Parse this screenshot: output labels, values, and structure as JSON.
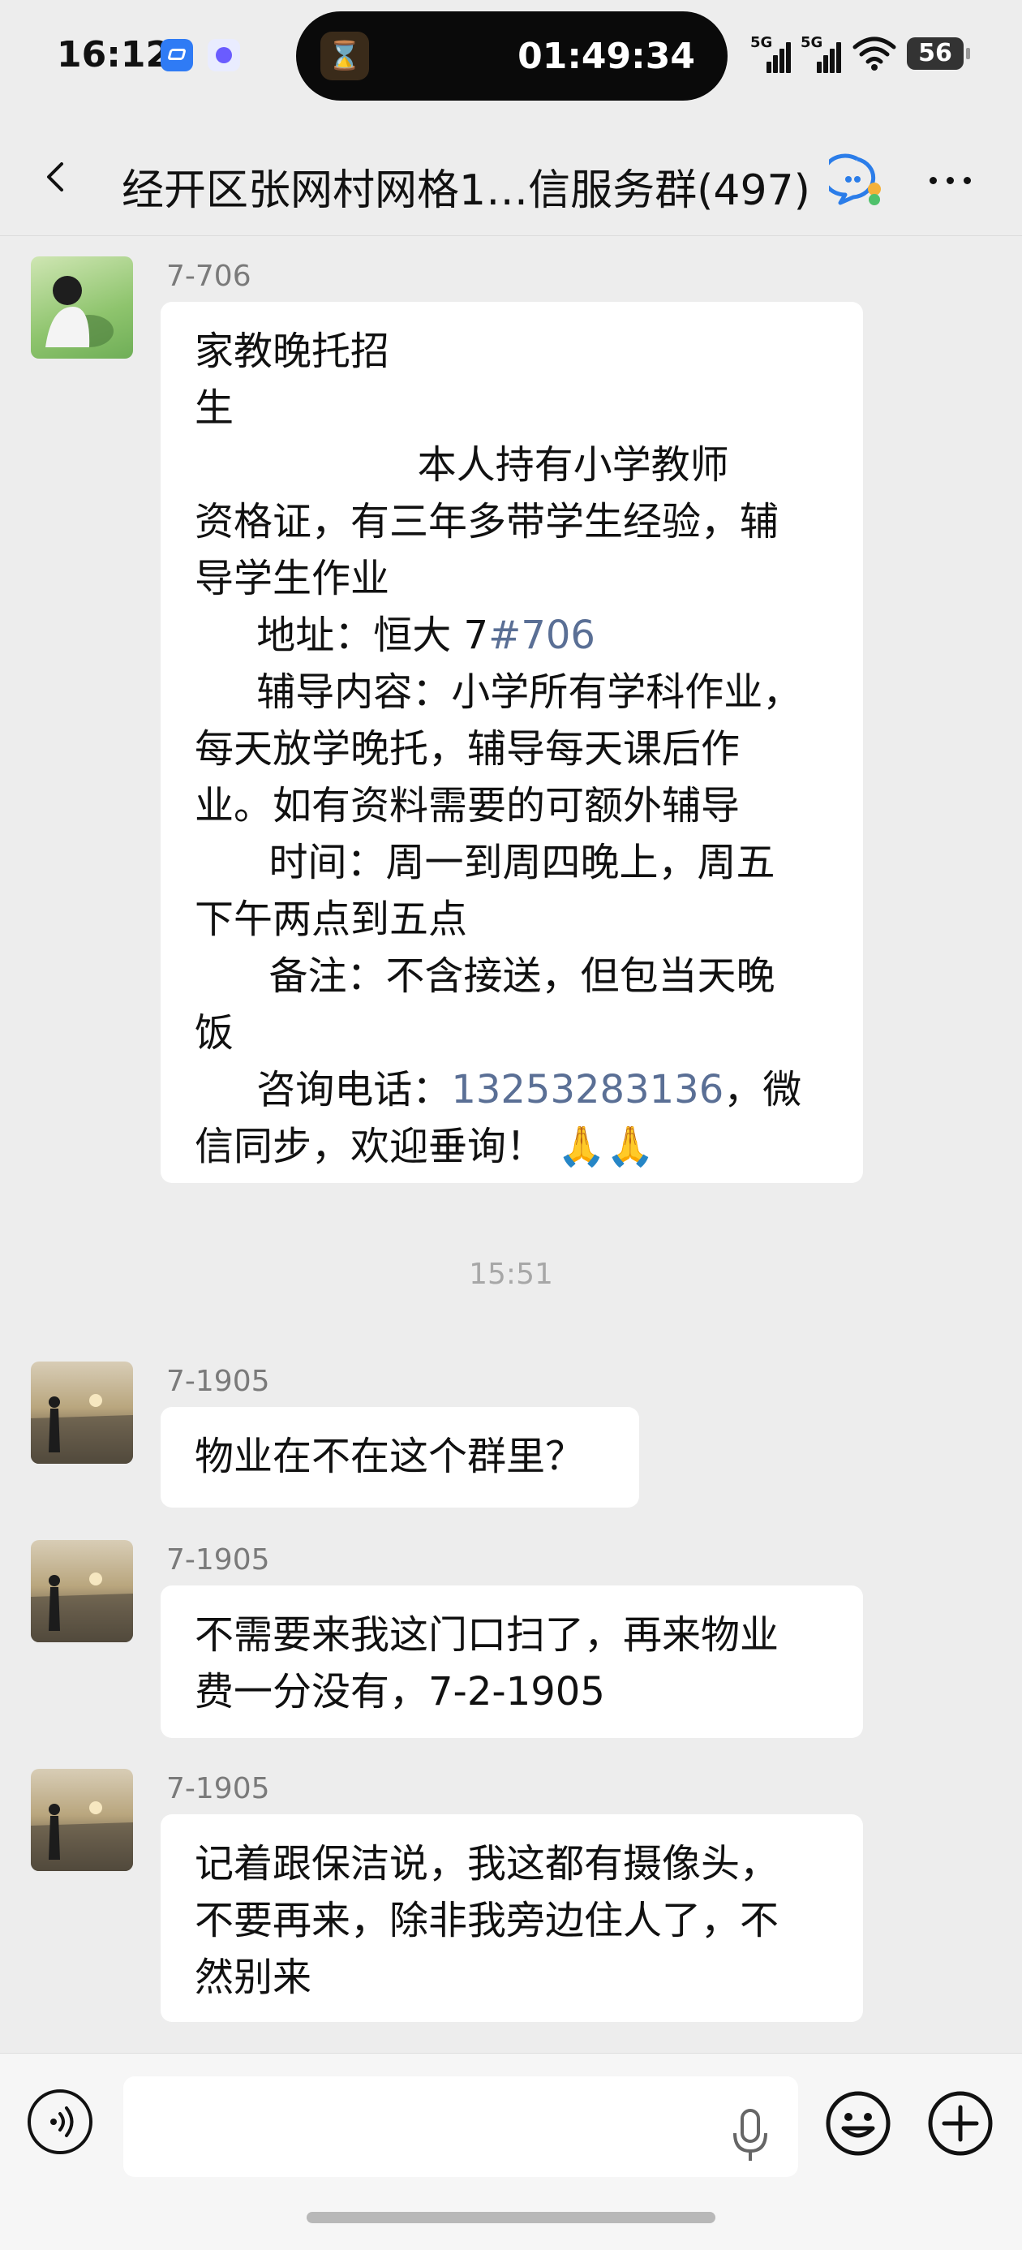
{
  "status_bar": {
    "time": "16:12",
    "timer": "01:49:34",
    "signal_1": "5G",
    "signal_2": "5G",
    "battery": "56",
    "icons": [
      "app-icon",
      "app-icon",
      "hourglass-icon",
      "wifi-icon"
    ]
  },
  "header": {
    "title": "经开区张网村网格1…信服务群(497)"
  },
  "messages": [
    {
      "sender": "7-706",
      "avatar": "avatar-green",
      "lines": [
        "家教晚托招",
        "生",
        "                  本人持有小学教师",
        "资格证，有三年多带学生经验，辅",
        "导学生作业",
        "     地址：恒大 7",
        "     辅导内容：小学所有学科作业，",
        "每天放学晚托，辅导每天课后作",
        "业。如有资料需要的可额外辅导",
        "      时间：周一到周四晚上，周五",
        "下午两点到五点",
        "      备注：不含接送，但包当天晚",
        "饭",
        "     咨询电话：",
        "信同步，欢迎垂询！"
      ],
      "link_address": "#706",
      "phone": "13253283136",
      "after_phone": "，微",
      "emoji": "🙏🙏"
    },
    {
      "sender": "7-1905",
      "avatar": "avatar-sunset",
      "text": "物业在不在这个群里？"
    },
    {
      "sender": "7-1905",
      "avatar": "avatar-sunset",
      "text": "不需要来我这门口扫了，再来物业\n费一分没有，7-2-1905"
    },
    {
      "sender": "7-1905",
      "avatar": "avatar-sunset",
      "text": "记着跟保洁说，我这都有摄像头，\n不要再来，除非我旁边住人了，不\n然别来"
    }
  ],
  "time_divider": "15:51",
  "input": {
    "placeholder": "",
    "value": ""
  }
}
